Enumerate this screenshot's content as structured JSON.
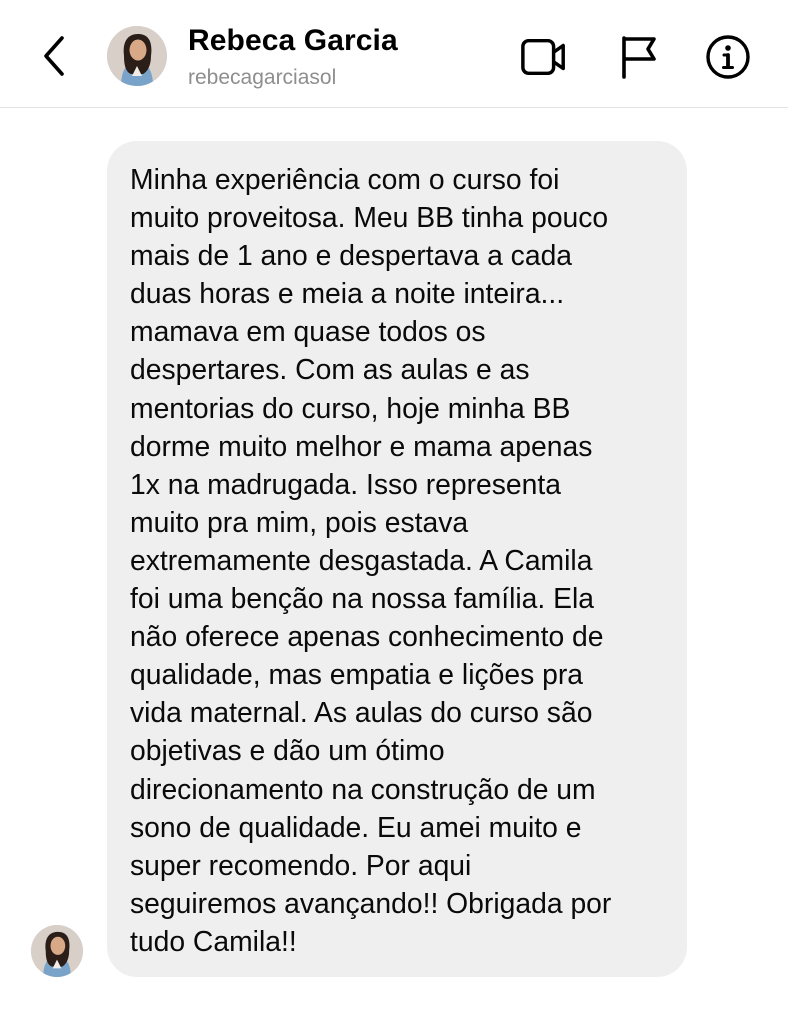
{
  "header": {
    "back_icon": "chevron-left-icon",
    "contact_name": "Rebeca Garcia",
    "contact_handle": "rebecagarciasol",
    "actions": [
      {
        "name": "video-call",
        "icon": "video-camera-icon"
      },
      {
        "name": "report",
        "icon": "flag-icon"
      },
      {
        "name": "info",
        "icon": "info-circle-icon"
      }
    ]
  },
  "conversation": {
    "message": {
      "text": "Minha experiência com o curso foi\nmuito proveitosa. Meu BB tinha pouco\nmais de 1 ano e despertava a cada\nduas horas e meia a noite inteira...\nmamava em quase todos os\ndespertares. Com as aulas e as\nmentorias do curso, hoje minha BB\ndorme muito melhor e mama apenas\n1x na madrugada. Isso representa\nmuito pra mim, pois estava\nextremamente desgastada. A Camila\nfoi uma benção na nossa família. Ela\nnão oferece apenas conhecimento de\nqualidade, mas empatia e lições pra\nvida maternal. As aulas do curso são\nobjetivas e dão um ótimo\ndirecionamento na construção de um\nsono de qualidade. Eu amei muito e\nsuper recomendo. Por aqui\nseguiremos avançando!! Obrigada por\ntudo Camila!!"
    }
  },
  "colors": {
    "bubble_background": "#efefef",
    "handle_text": "#8e8e8e",
    "divider": "#e3e3e3",
    "icon_stroke": "#000000"
  }
}
